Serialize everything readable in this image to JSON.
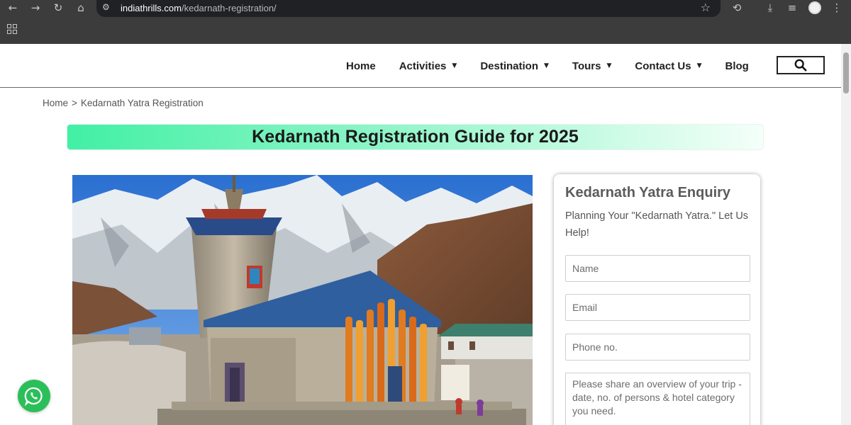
{
  "browser": {
    "url_host": "indiathrills.com",
    "url_path": "/kedarnath-registration/",
    "icons": [
      "back-icon",
      "forward-icon",
      "reload-icon",
      "home-icon",
      "site-settings-icon",
      "bookmark-star-icon",
      "history-icon",
      "download-icon",
      "reading-list-icon",
      "profile-avatar",
      "menu-icon",
      "apps-icon"
    ]
  },
  "nav": {
    "items": [
      {
        "label": "Home",
        "dropdown": false
      },
      {
        "label": "Activities",
        "dropdown": true
      },
      {
        "label": "Destination",
        "dropdown": true
      },
      {
        "label": "Tours",
        "dropdown": true
      },
      {
        "label": "Contact Us",
        "dropdown": true
      },
      {
        "label": "Blog",
        "dropdown": false
      }
    ],
    "search_icon": "search-icon"
  },
  "breadcrumb": {
    "home": "Home",
    "separator": ">",
    "current": "Kedarnath Yatra Registration"
  },
  "banner": {
    "title": "Kedarnath Registration Guide for 2025"
  },
  "hero": {
    "image": "kedarnath-temple-photo"
  },
  "enquiry": {
    "title": "Kedarnath Yatra Enquiry",
    "subtitle": "Planning Your \"Kedarnath Yatra.\" Let Us Help!",
    "name_placeholder": "Name",
    "email_placeholder": "Email",
    "phone_placeholder": "Phone no.",
    "message_placeholder": "Please share an overview of your trip - date, no. of persons & hotel category you need."
  },
  "colors": {
    "banner_start": "#42f0a4",
    "banner_end": "#f4fff9",
    "whatsapp": "#2bbf5a",
    "nav_text": "#222222"
  },
  "floating": {
    "whatsapp_icon": "whatsapp-icon"
  }
}
